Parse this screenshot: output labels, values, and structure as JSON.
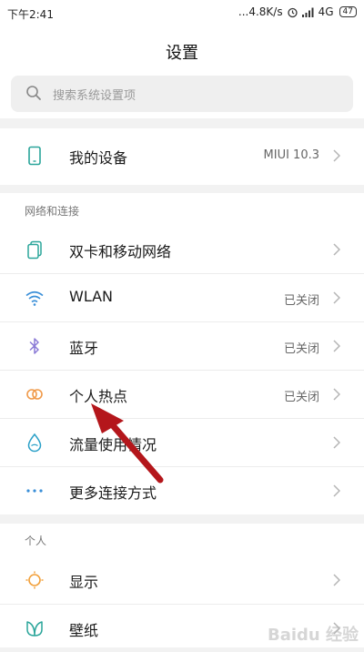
{
  "status_bar": {
    "time": "下午2:41",
    "speed": "...4.8K/s",
    "network": "4G",
    "battery": "47"
  },
  "header": {
    "title": "设置",
    "search_placeholder": "搜索系统设置项"
  },
  "device_section": {
    "label": "我的设备",
    "value": "MIUI 10.3",
    "icon": "phone-icon"
  },
  "network_section": {
    "header": "网络和连接",
    "items": [
      {
        "label": "双卡和移动网络",
        "value": "",
        "icon": "sim-card-icon"
      },
      {
        "label": "WLAN",
        "value": "已关闭",
        "icon": "wifi-icon"
      },
      {
        "label": "蓝牙",
        "value": "已关闭",
        "icon": "bluetooth-icon"
      },
      {
        "label": "个人热点",
        "value": "已关闭",
        "icon": "hotspot-icon"
      },
      {
        "label": "流量使用情况",
        "value": "",
        "icon": "data-drop-icon"
      },
      {
        "label": "更多连接方式",
        "value": "",
        "icon": "more-dots-icon"
      }
    ]
  },
  "personal_section": {
    "header": "个人",
    "items": [
      {
        "label": "显示",
        "value": "",
        "icon": "display-sun-icon"
      },
      {
        "label": "壁纸",
        "value": "",
        "icon": "wallpaper-icon"
      }
    ]
  },
  "watermark": "Baidu 经验",
  "colors": {
    "accent_teal": "#2aa59a",
    "wifi_blue": "#3a8fd8",
    "bluetooth_purple": "#8a7ad6",
    "hotspot_orange": "#f09a4a",
    "display_orange": "#f2a03a",
    "annotation_red": "#b4161b"
  }
}
